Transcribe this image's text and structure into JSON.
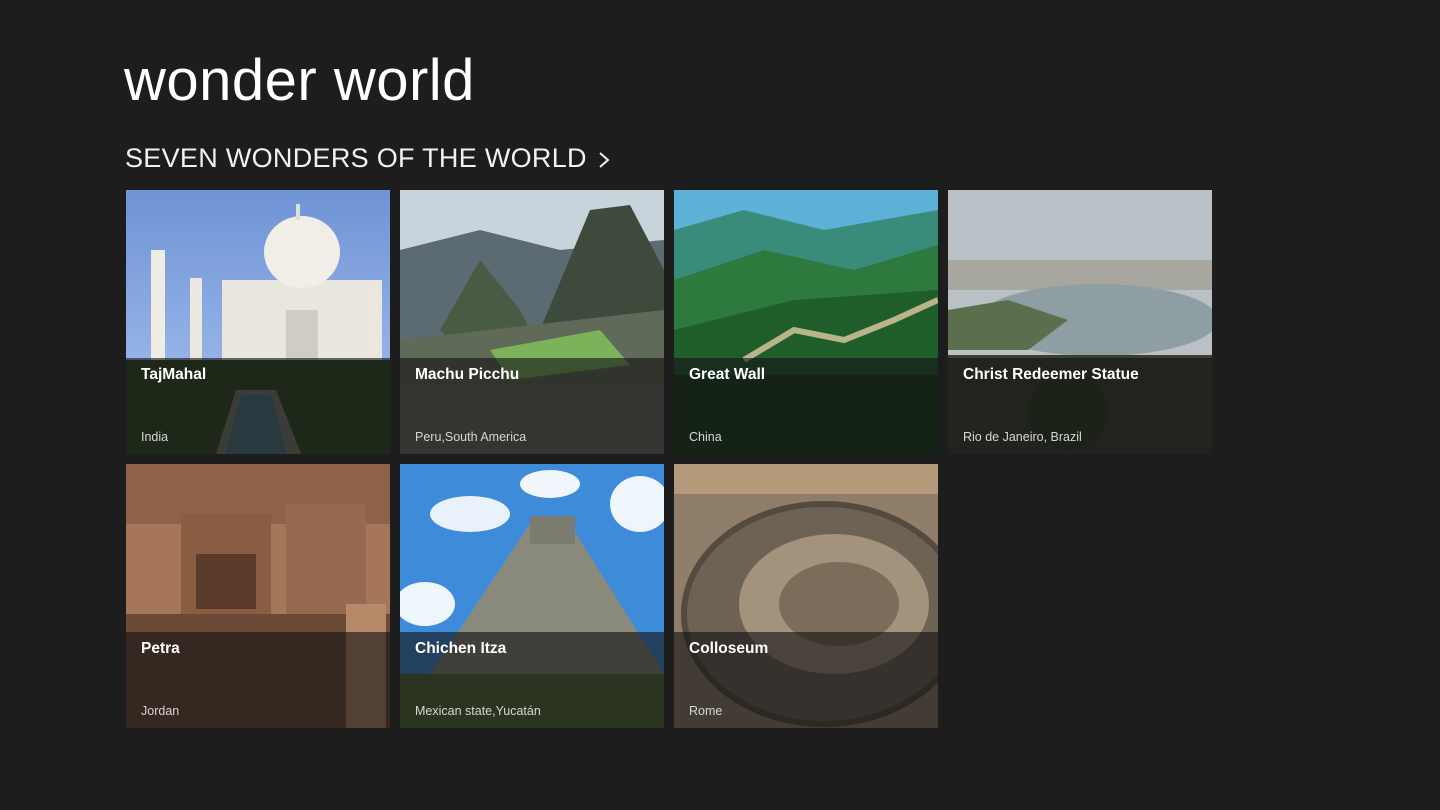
{
  "app": {
    "title": "wonder world"
  },
  "section": {
    "title": "SEVEN WONDERS OF THE WORLD",
    "chevron_icon": "chevron-right-icon"
  },
  "wonders": [
    {
      "name": "TajMahal",
      "location": "India"
    },
    {
      "name": "Machu Picchu",
      "location": "Peru,South America"
    },
    {
      "name": "Great Wall",
      "location": "China"
    },
    {
      "name": "Christ Redeemer Statue",
      "location": "Rio de Janeiro, Brazil"
    },
    {
      "name": "Petra",
      "location": "Jordan"
    },
    {
      "name": "Chichen Itza",
      "location": "Mexican state,Yucatán"
    },
    {
      "name": "Colloseum",
      "location": "Rome"
    }
  ],
  "colors": {
    "background": "#1d1d1d",
    "overlay": "rgba(20,20,20,0.62)",
    "text": "#ffffff"
  }
}
